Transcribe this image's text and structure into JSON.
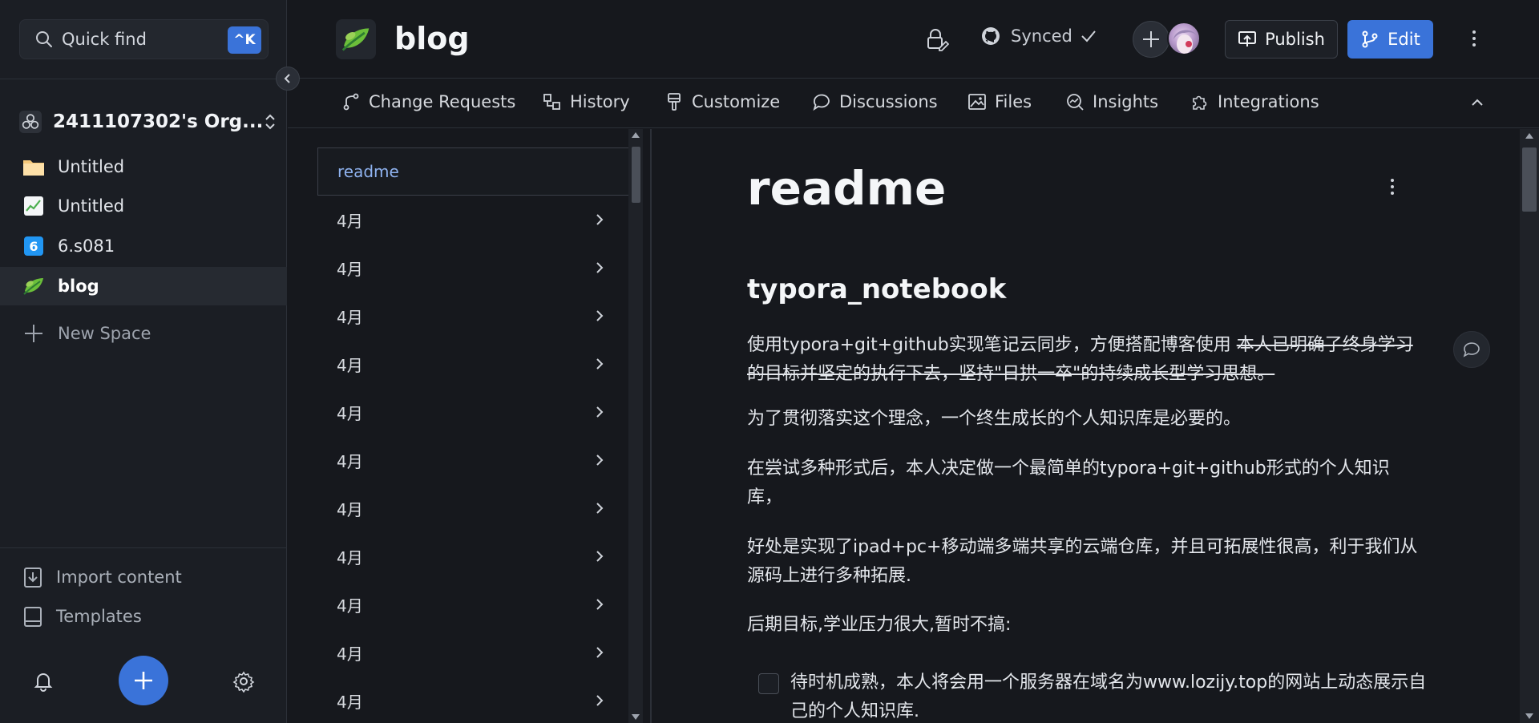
{
  "sidebar": {
    "quick_find_label": "Quick find",
    "quick_find_shortcut": "^K",
    "org_name": "2411107302's Org...",
    "spaces": [
      {
        "label": "Untitled",
        "icon": "folder-icon"
      },
      {
        "label": "Untitled",
        "icon": "chart-icon"
      },
      {
        "label": "6.s081",
        "icon": "number-6-icon"
      },
      {
        "label": "blog",
        "icon": "leaf-icon",
        "active": true
      }
    ],
    "new_space_label": "New Space",
    "import_label": "Import content",
    "templates_label": "Templates"
  },
  "header": {
    "space_title": "blog",
    "synced_label": "Synced",
    "publish_label": "Publish",
    "edit_label": "Edit"
  },
  "tabs": [
    {
      "label": "Change Requests",
      "icon": "change-request-icon"
    },
    {
      "label": "History",
      "icon": "history-icon"
    },
    {
      "label": "Customize",
      "icon": "brush-icon"
    },
    {
      "label": "Discussions",
      "icon": "chat-bubble-icon"
    },
    {
      "label": "Files",
      "icon": "image-icon"
    },
    {
      "label": "Insights",
      "icon": "insights-icon"
    },
    {
      "label": "Integrations",
      "icon": "puzzle-icon"
    }
  ],
  "tree": {
    "active_label": "readme",
    "items": [
      "4月",
      "4月",
      "4月",
      "4月",
      "4月",
      "4月",
      "4月",
      "4月",
      "4月",
      "4月",
      "4月"
    ]
  },
  "doc": {
    "title": "readme",
    "heading": "typora_notebook",
    "p1_normal": "使用typora+git+github实现笔记云同步，方便搭配博客使用 ",
    "p1_strike": "本人已明确了终身学习的目标并坚定的执行下去，坚持\"日拱一卒\"的持续成长型学习思想。",
    "p2": "为了贯彻落实这个理念，一个终生成长的个人知识库是必要的。",
    "p3": "在尝试多种形式后，本人决定做一个最简单的typora+git+github形式的个人知识库，",
    "p4": "好处是实现了ipad+pc+移动端多端共享的云端仓库，并且可拓展性很高，利于我们从源码上进行多种拓展.",
    "p5": "后期目标,学业压力很大,暂时不搞:",
    "task1": "待时机成熟，本人将会用一个服务器在域名为www.lozijy.top的网站上动态展示自己的个人知识库."
  },
  "colors": {
    "accent": "#3a73d9",
    "background": "#16181d",
    "sidebar": "#1b1e24"
  }
}
